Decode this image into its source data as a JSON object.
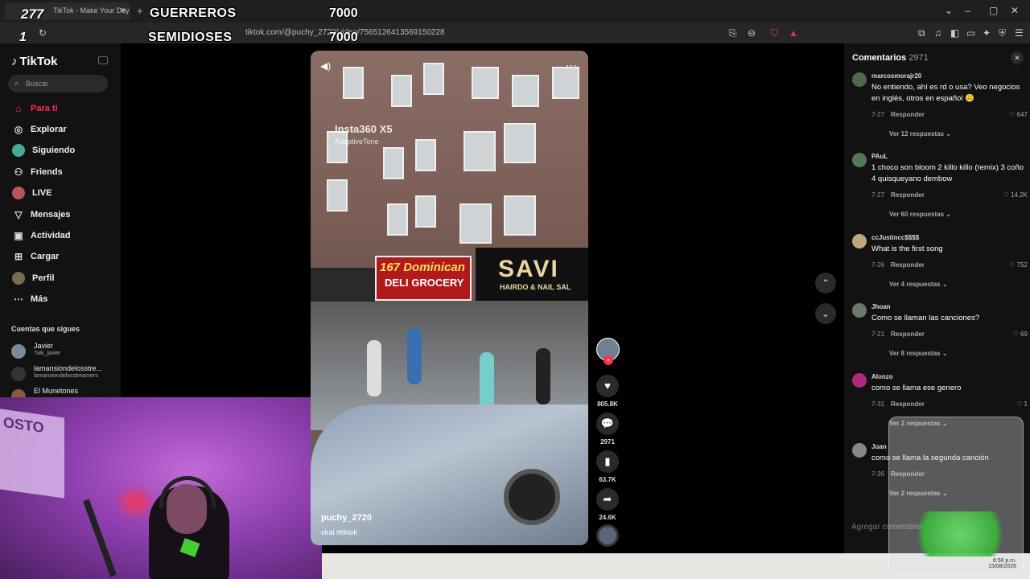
{
  "browser": {
    "tab_title": "TikTok - Make Your Day",
    "url": "tiktok.com/@puchy_2720/video/7565126413569150228",
    "tab_close": "×",
    "new_tab": "+"
  },
  "overlay": {
    "top_left_count": "277",
    "secondary_count": "1",
    "rows": [
      {
        "label": "GUERREROS",
        "value": "7000"
      },
      {
        "label": "SEMIDIOSES",
        "value": "7000"
      }
    ]
  },
  "sidebar": {
    "logo": "TikTok",
    "search_placeholder": "Buscar",
    "items": [
      {
        "label": "Para ti",
        "icon": "home-icon",
        "glyph": "⌂"
      },
      {
        "label": "Explorar",
        "icon": "compass-icon",
        "glyph": "◎"
      },
      {
        "label": "Siguiendo",
        "icon": "following-avatar",
        "glyph": ""
      },
      {
        "label": "Friends",
        "icon": "friends-icon",
        "glyph": "⚇"
      },
      {
        "label": "LIVE",
        "icon": "live-avatar",
        "glyph": ""
      },
      {
        "label": "Mensajes",
        "icon": "send-icon",
        "glyph": "▽"
      },
      {
        "label": "Actividad",
        "icon": "activity-icon",
        "glyph": "▣"
      },
      {
        "label": "Cargar",
        "icon": "upload-icon",
        "glyph": "⊞"
      },
      {
        "label": "Perfil",
        "icon": "profile-avatar",
        "glyph": ""
      },
      {
        "label": "Más",
        "icon": "more-icon",
        "glyph": "⋯"
      }
    ],
    "following_heading": "Cuentas que sigues",
    "following": [
      {
        "name": "Javier",
        "handle": "7wk_javier"
      },
      {
        "name": "lamansiondelosstre...",
        "handle": "lamansiondelosstreamers"
      },
      {
        "name": "El Munetones",
        "handle": ""
      }
    ]
  },
  "video": {
    "watermark": "Insta360 X5",
    "watermark_sub": "AdaptiveTone",
    "sign_left_top": "167 Dominican",
    "sign_left_bottom": "DELI GROCERY",
    "sign_right_top": "SAVI",
    "sign_right_bottom": "HAIRDO & NAIL SAL",
    "author": "puchy_2720",
    "caption": "viral #tiktok"
  },
  "actions": {
    "likes": "805.8K",
    "comments": "2971",
    "saves": "63.7K",
    "shares": "24.6K"
  },
  "comments": {
    "title": "Comentarios",
    "count": "2971",
    "input_placeholder": "Agregar comentario...",
    "items": [
      {
        "user": "marcosmorajr20",
        "text": "No entiendo, ahí es rd o usa? Veo negocios en inglés, otros en español 🙃",
        "date": "7-27",
        "reply": "Responder",
        "likes": "647",
        "replies": "Ver 12 respuestas"
      },
      {
        "user": "PAuL",
        "text": "1 choco son bloom 2 killo killo (remix) 3 coño 4 quisqueyano dembow",
        "date": "7-27",
        "reply": "Responder",
        "likes": "14.2K",
        "replies": "Ver 60 respuestas"
      },
      {
        "user": "ccJustincc$$$$",
        "text": "What is the first song",
        "date": "7-26",
        "reply": "Responder",
        "likes": "752",
        "replies": "Ver 4 respuestas"
      },
      {
        "user": "Jhoan",
        "text": "Como se llaman las canciones?",
        "date": "7-21",
        "reply": "Responder",
        "likes": "69",
        "replies": "Ver 8 respuestas"
      },
      {
        "user": "Alonzo",
        "text": "como se llama ese genero",
        "date": "7-31",
        "reply": "Responder",
        "likes": "1",
        "replies": "Ver 2 respuestas"
      },
      {
        "user": "Juan",
        "text": "como se llama la segunda canción",
        "date": "7-26",
        "reply": "Responder",
        "likes": "",
        "replies": "Ver 2 respuestas"
      }
    ]
  },
  "taskbar": {
    "time": "6:56 p.m.",
    "date": "15/08/2026"
  },
  "colors": {
    "accent": "#fe2c55",
    "background": "#000000",
    "panel": "#121212"
  }
}
